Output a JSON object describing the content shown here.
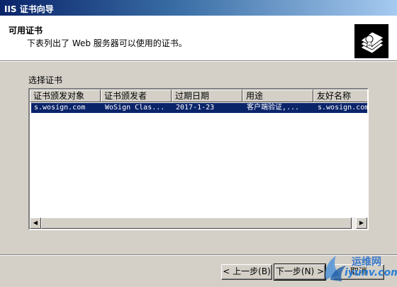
{
  "window": {
    "title": "IIS 证书向导"
  },
  "header": {
    "title": "可用证书",
    "subtitle": "下表列出了 Web 服务器可以使用的证书。"
  },
  "group_label": "选择证书",
  "table": {
    "columns": [
      "证书颁发对象",
      "证书颁发者",
      "过期日期",
      "用途",
      "友好名称"
    ],
    "rows": [
      [
        "s.wosign.com",
        "WoSign Clas...",
        "2017-1-23",
        "客户端验证,...",
        "s.wosign.com"
      ]
    ]
  },
  "scrollbar": {
    "left_arrow": "◀",
    "right_arrow": "▶"
  },
  "buttons": {
    "back": "< 上一步(B)",
    "next": "下一步(N) >",
    "cancel": "取消"
  },
  "watermark": {
    "line1": "运维网",
    "line2": "iyunv.com"
  },
  "colors": {
    "titlebar": "#0a246a",
    "selection": "#0a246a",
    "dialog": "#d4d0c8"
  }
}
